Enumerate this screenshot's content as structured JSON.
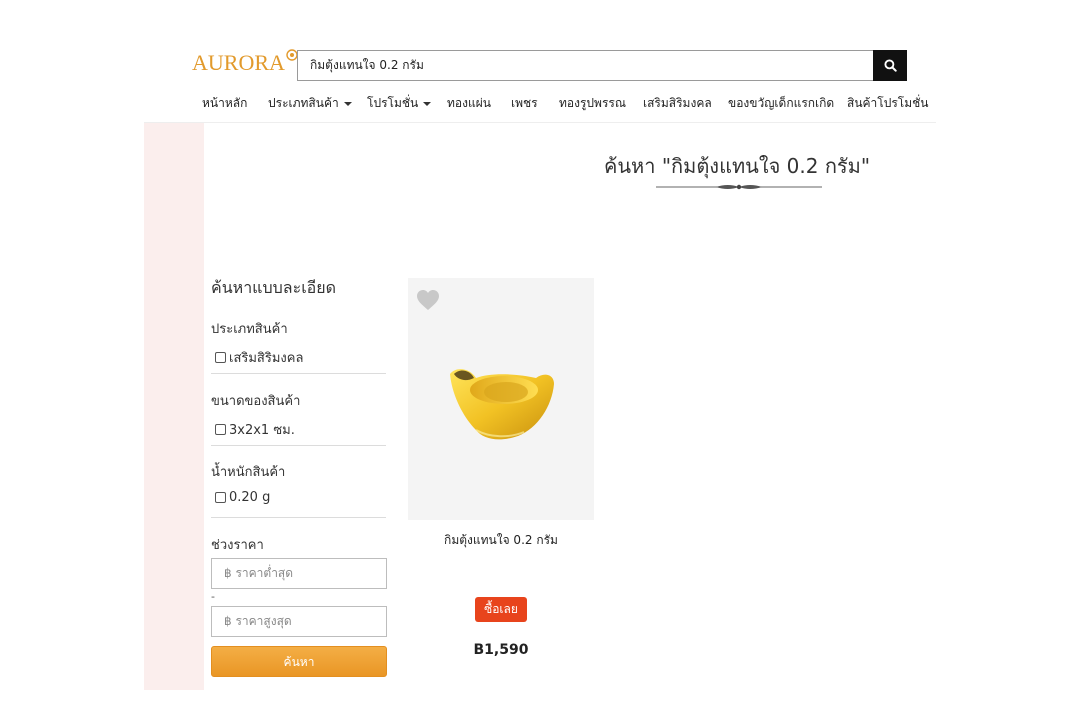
{
  "header": {
    "logo_text": "AURORA",
    "search_value": "กิมตุ้งแทนใจ 0.2 กรัม",
    "brand_color": "#e29a2c"
  },
  "nav": {
    "items": [
      {
        "label": "หน้าหลัก",
        "dropdown": false
      },
      {
        "label": "ประเภทสินค้า",
        "dropdown": true
      },
      {
        "label": "โปรโมชั่น",
        "dropdown": true
      },
      {
        "label": "ทองแผ่น",
        "dropdown": false
      },
      {
        "label": "เพชร",
        "dropdown": false
      },
      {
        "label": "ทองรูปพรรณ",
        "dropdown": false
      },
      {
        "label": "เสริมสิริมงคล",
        "dropdown": false
      },
      {
        "label": "ของขวัญเด็กแรกเกิด",
        "dropdown": false
      },
      {
        "label": "สินค้าโปรโมชั่น",
        "dropdown": false
      }
    ]
  },
  "page": {
    "title": "ค้นหา \"กิมตุ้งแทนใจ 0.2 กรัม\""
  },
  "filter": {
    "heading": "ค้นหาแบบละเอียด",
    "groups": [
      {
        "label": "ประเภทสินค้า",
        "option": "เสริมสิริมงคล"
      },
      {
        "label": "ขนาดของสินค้า",
        "option": "3x2x1 ซม."
      },
      {
        "label": "น้ำหนักสินค้า",
        "option": "0.20 g"
      }
    ],
    "price_label": "ช่วงราคา",
    "min_placeholder": "฿ ราคาต่ำสุด",
    "separator": "-",
    "max_placeholder": "฿ ราคาสูงสุด",
    "submit_label": "ค้นหา"
  },
  "product": {
    "name": "กิมตุ้งแทนใจ 0.2 กรัม",
    "buy_label": "ซื้อเลย",
    "price": "B1,590"
  },
  "icons": {
    "search": "search-icon",
    "heart": "heart-icon",
    "ornament": "divider-ornament-icon"
  }
}
